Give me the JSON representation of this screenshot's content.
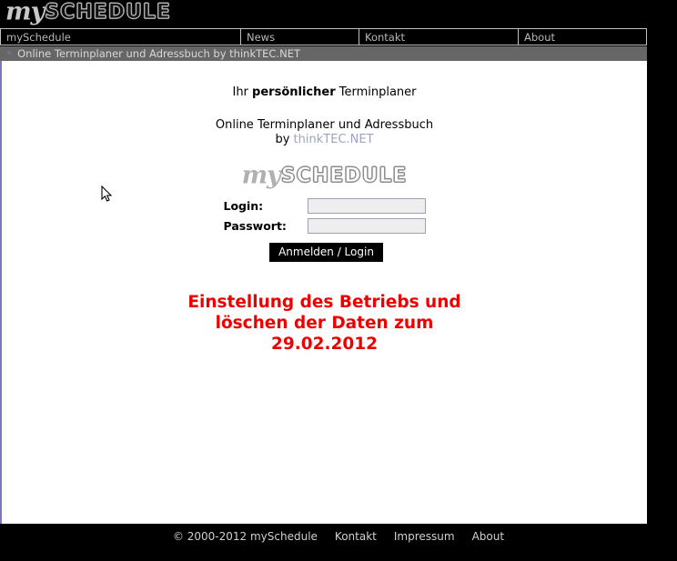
{
  "header": {
    "logo_my": "my",
    "logo_schedule": "SCHEDULE"
  },
  "nav": {
    "items": [
      {
        "label": "mySchedule"
      },
      {
        "label": "News"
      },
      {
        "label": "Kontakt"
      },
      {
        "label": "About"
      }
    ]
  },
  "breadcrumb": {
    "arrow": "»",
    "text": "Online Terminplaner und Adressbuch by thinkTEC.NET"
  },
  "main": {
    "tagline_pre": "Ihr ",
    "tagline_bold": "persönlicher",
    "tagline_post": " Terminplaner",
    "subtitle_line1": "Online Terminplaner und Adressbuch",
    "subtitle_by": "by ",
    "subtitle_link": "thinkTEC.NET",
    "logo_my": "my",
    "logo_schedule": "SCHEDULE",
    "form": {
      "login_label": "Login:",
      "login_value": "",
      "login_placeholder": "",
      "password_label": "Passwort:",
      "password_value": "",
      "password_placeholder": "",
      "submit_label": "Anmelden / Login"
    },
    "notice_line1": "Einstellung des Betriebs und",
    "notice_line2": "löschen der Daten zum",
    "notice_line3": "29.02.2012",
    "notice_color": "#ee0000"
  },
  "footer": {
    "copyright": "© 2000-2012 mySchedule",
    "links": [
      {
        "label": "Kontakt"
      },
      {
        "label": "Impressum"
      },
      {
        "label": "About"
      }
    ]
  }
}
